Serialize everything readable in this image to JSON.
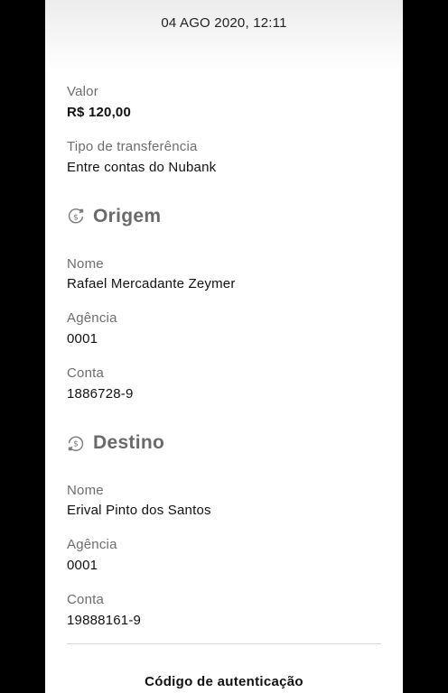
{
  "header": {
    "date": "04 AGO 2020, 12:11"
  },
  "transfer": {
    "value_label": "Valor",
    "value": "R$ 120,00",
    "type_label": "Tipo de transferência",
    "type": "Entre contas do Nubank"
  },
  "origin": {
    "title": "Origem",
    "icon": "money-out-icon",
    "name_label": "Nome",
    "name": "Rafael Mercadante Zeymer",
    "agency_label": "Agência",
    "agency": "0001",
    "account_label": "Conta",
    "account": "1886728-9"
  },
  "destination": {
    "title": "Destino",
    "icon": "money-in-icon",
    "name_label": "Nome",
    "name": "Erival Pinto dos Santos",
    "agency_label": "Agência",
    "agency": "0001",
    "account_label": "Conta",
    "account": "19888161-9"
  },
  "footer": {
    "auth_label": "Código de autenticação"
  }
}
